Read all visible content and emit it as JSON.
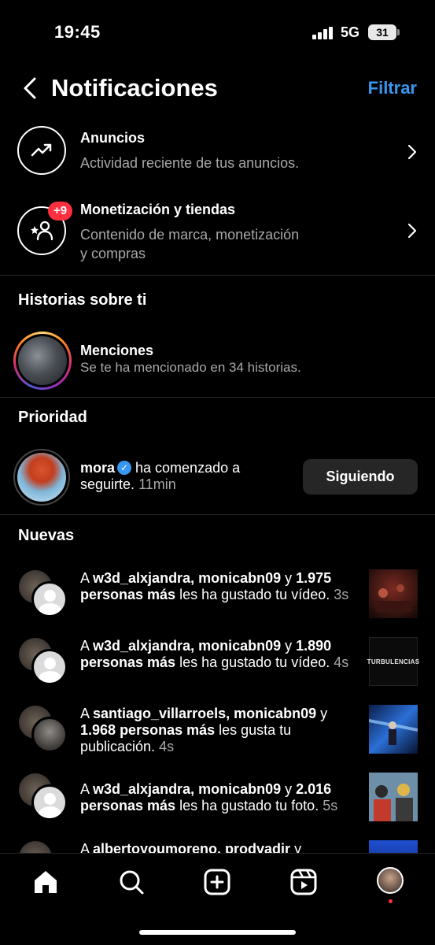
{
  "status_bar": {
    "time": "19:45",
    "network": "5G",
    "battery": "31"
  },
  "header": {
    "title": "Notificaciones",
    "filter_label": "Filtrar"
  },
  "rows": [
    {
      "title": "Anuncios",
      "subtitle": "Actividad reciente de tus anuncios."
    },
    {
      "title": "Monetización y tiendas",
      "subtitle_line1": "Contenido de marca, monetización",
      "subtitle_line2": "y compras",
      "badge": "+9"
    }
  ],
  "stories_section": {
    "title": "Historias sobre ti",
    "mentions_title": "Menciones",
    "mentions_subtitle": "Se te ha mencionado en 34 historias."
  },
  "priority_section": {
    "title": "Prioridad",
    "username": "mora",
    "text_line1": " ha comenzado a",
    "text_line2": "seguirte.",
    "time": "11min",
    "button_label": "Siguiendo"
  },
  "new_section": {
    "title": "Nuevas",
    "items": [
      {
        "users": "w3d_alxjandra, monicabn09",
        "rest": "1.975",
        "others": "personas más",
        "action": " les ha gustado tu",
        "tail": "vídeo.",
        "time": "3s"
      },
      {
        "users": "w3d_alxjandra, monicabn09",
        "rest": "1.890",
        "others": "personas más",
        "action": " les ha gustado tu",
        "tail": "vídeo.",
        "time": "4s"
      },
      {
        "users": "santiago_villarroels, monicabn09",
        "rest": "1.968",
        "others": "personas más",
        "action": " les gusta tu",
        "tail": "publicación.",
        "time": "4s"
      },
      {
        "users": "w3d_alxjandra, monicabn09",
        "rest": "2.016",
        "others": "personas más",
        "action": " les ha gustado tu foto.",
        "tail": "",
        "time": "5s"
      },
      {
        "users": "albertoyoumoreno, prodvadir",
        "rest": "",
        "others": "",
        "action": "",
        "tail": "",
        "time": ""
      }
    ],
    "thumb2_text": "TURBULENCIAS"
  },
  "icons": {
    "back": "chevron-left-icon",
    "ads": "trending-up-icon",
    "monetization": "star-person-icon",
    "tabs": [
      "home-icon",
      "search-icon",
      "create-icon",
      "reels-icon",
      "profile-icon"
    ]
  },
  "colors": {
    "accent": "#3897f0",
    "badge": "#ff3040",
    "secondary_text": "#a8a8a8"
  }
}
